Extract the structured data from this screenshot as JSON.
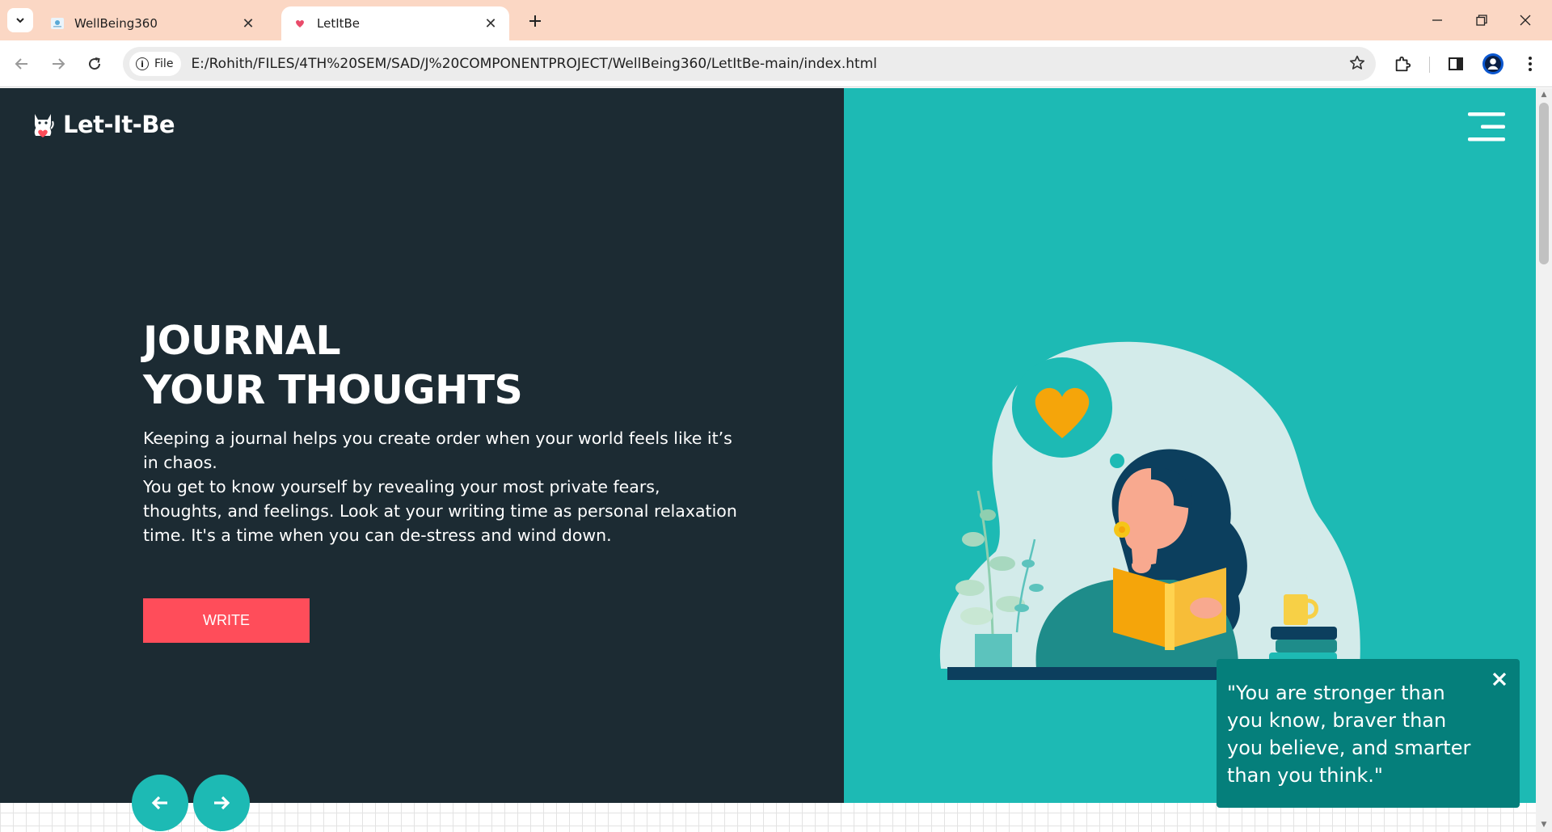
{
  "browser": {
    "tabs": [
      {
        "title": "WellBeing360",
        "active": false
      },
      {
        "title": "LetItBe",
        "active": true
      }
    ],
    "address": {
      "scheme_chip": "File",
      "url": "E:/Rohith/FILES/4TH%20SEM/SAD/J%20COMPONENTPROJECT/WellBeing360/LetItBe-main/index.html"
    }
  },
  "page": {
    "brand": "Let-It-Be",
    "hero": {
      "title_line1": "JOURNAL",
      "title_line2": "YOUR THOUGHTS",
      "paragraph1": "Keeping a journal helps you create order when your world feels like it’s in chaos.",
      "paragraph2": "You get to know yourself by revealing your most private fears, thoughts, and feelings. Look at your writing time as personal relaxation time. It's a time when you can de-stress and wind down.",
      "cta_label": "WRITE"
    },
    "quote": "\"You are stronger than you know, braver than you believe, and smarter than you think.\""
  },
  "colors": {
    "dark_panel": "#1c2b33",
    "teal_panel": "#1dbab4",
    "cta": "#ff4d5a",
    "quote_card": "#057f7b",
    "tab_strip": "#fbd7c4"
  },
  "icons": [
    "tab-search-icon",
    "back-icon",
    "forward-icon",
    "reload-icon",
    "info-icon",
    "star-icon",
    "extensions-icon",
    "side-panel-icon",
    "profile-icon",
    "menu-icon",
    "hamburger-icon",
    "close-icon",
    "arrow-left-icon",
    "arrow-right-icon"
  ]
}
